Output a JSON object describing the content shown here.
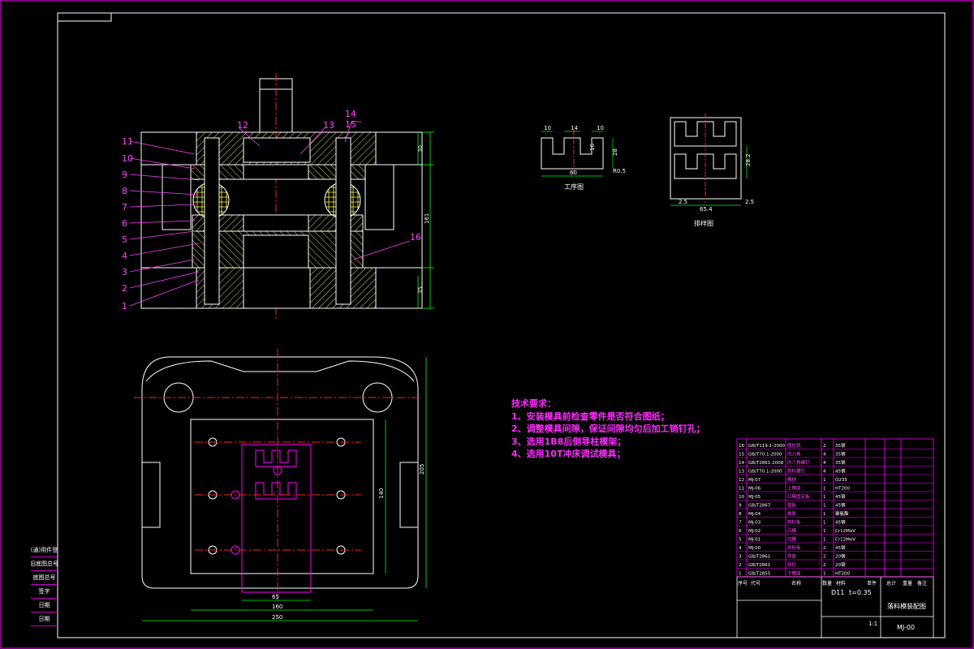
{
  "tech_requirements": {
    "heading": "技术要求：",
    "items": [
      "1、安装模具前检查零件是否符合图纸；",
      "2、调整模具间隙，保证间隙均匀后加工销钉孔；",
      "3、选用1B8后侧导柱模架；",
      "4、选用10T冲床调试模具；"
    ]
  },
  "part_labels": [
    "1",
    "2",
    "3",
    "4",
    "5",
    "6",
    "7",
    "8",
    "9",
    "10",
    "11",
    "12",
    "13",
    "14",
    "15",
    "16"
  ],
  "section_dims": {
    "top_thickness": "30",
    "height": "161",
    "base_thickness": "35"
  },
  "plan_dims": {
    "width_total": "250",
    "width_inner": "160",
    "width_small": "65",
    "height_right": "205",
    "height_inner": "140"
  },
  "process_drawing": {
    "title": "工序图",
    "d1": "10",
    "d2": "14",
    "d3": "10",
    "d4": "16",
    "d5": "28",
    "width": "60",
    "r": "R0.5"
  },
  "layout_drawing": {
    "title": "排样图",
    "d1": "28.2",
    "d2": "2.5",
    "d3": "2.5",
    "width": "65.4"
  },
  "title_block": {
    "drawing_title": "落料模装配图",
    "code": "MJ-00",
    "material": "D11",
    "thickness": "t=0.35",
    "scale": "1:1",
    "headers": [
      "序号",
      "代号",
      "名称",
      "数量",
      "材料",
      "单件",
      "总计",
      "重量",
      "备注"
    ],
    "rows": [
      [
        "16",
        "GB/T119.1-2000",
        "圆柱销",
        "2",
        "35钢"
      ],
      [
        "15",
        "GB/T70.1-2000",
        "内六角",
        "4",
        "35钢"
      ],
      [
        "14",
        "GB/T2861-2008",
        "内六角螺钉",
        "4",
        "35钢"
      ],
      [
        "13",
        "GB/T70.1-2000",
        "卸料螺钉",
        "4",
        "45钢"
      ],
      [
        "12",
        "MJ-07",
        "模柄",
        "1",
        "Q235"
      ],
      [
        "11",
        "MJ-06",
        "上模座",
        "1",
        "HT200"
      ],
      [
        "10",
        "MJ-05",
        "凸模固定板",
        "1",
        "45钢"
      ],
      [
        "9",
        "GB/T2867",
        "垫板",
        "1",
        "45钢"
      ],
      [
        "8",
        "MJ-04",
        "橡胶",
        "1",
        "聚氨酯"
      ],
      [
        "7",
        "MJ-03",
        "卸料板",
        "1",
        "45钢"
      ],
      [
        "6",
        "MJ-02",
        "凸模",
        "1",
        "Cr12MoV"
      ],
      [
        "5",
        "MJ-01",
        "凹模",
        "1",
        "Cr12MoV"
      ],
      [
        "4",
        "MJ-00",
        "导料板",
        "2",
        "45钢"
      ],
      [
        "3",
        "GB/T2861",
        "导套",
        "2",
        "20钢"
      ],
      [
        "2",
        "GB/T2861",
        "导柱",
        "2",
        "20钢"
      ],
      [
        "1",
        "GB/T2855",
        "下模座",
        "1",
        "HT200"
      ]
    ],
    "labels": [
      "标记",
      "处数",
      "分区",
      "更改文件号",
      "签名",
      "年月日",
      "设计",
      "标准化",
      "阶段标记",
      "重量",
      "比例",
      "审核",
      "工艺",
      "批准",
      "共 张",
      "第 张"
    ]
  },
  "side_table": [
    "借(通)用件登记",
    "旧底图总号",
    "底图总号",
    "签字",
    "日期",
    "日期"
  ],
  "colors": {
    "frame": "#ff00ff",
    "outline": "#ffffff",
    "label": "#ff44ff",
    "center": "#ff2222",
    "dim": "#00ff00",
    "hatch": "#ffff44"
  }
}
